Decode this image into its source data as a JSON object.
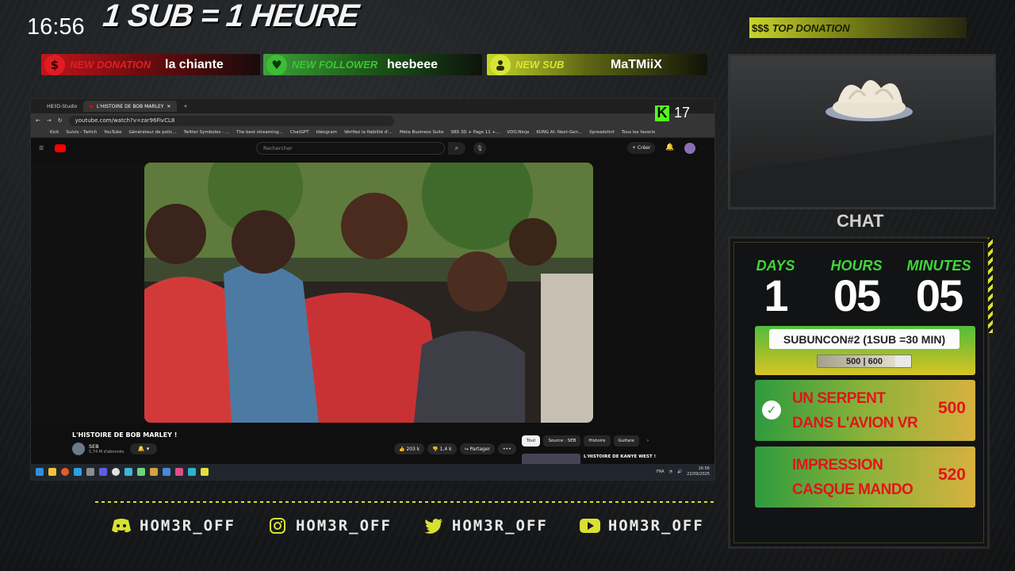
{
  "clock": "16:56",
  "headline": "1 SUB = 1 HEURE",
  "alerts": {
    "donation": {
      "label": "NEW DONATION",
      "value": "la chiante",
      "icon": "dollar-icon"
    },
    "follower": {
      "label": "NEW FOLLOWER",
      "value": "heebeee",
      "icon": "heart-icon"
    },
    "sub": {
      "label": "NEW SUB",
      "value": "MaTMiiX",
      "icon": "user-group-icon"
    }
  },
  "top_donation": {
    "icon_text": "$$$",
    "label": "TOP DONATION"
  },
  "chat_title": "CHAT",
  "timer": {
    "days_label": "DAYS",
    "days": "1",
    "hours_label": "HOURS",
    "hours": "05",
    "minutes_label": "MINUTES",
    "minutes": "05"
  },
  "subathon": {
    "title": "SUBUNCON#2 (1SUB =30 MIN)",
    "progress_text": "500 | 600",
    "current": 500,
    "goal": 600
  },
  "goals": [
    {
      "text": "UN SERPENT DANS L'AVION VR",
      "value": "500",
      "done": true
    },
    {
      "text": "IMPRESSION CASQUE MANDO",
      "value": "520",
      "done": false
    }
  ],
  "kick": {
    "viewers": "17"
  },
  "browser": {
    "tabs": [
      "HB3D-Studio",
      "L'HISTOIRE DE BOB MARLEY"
    ],
    "url": "youtube.com/watch?v=zar96FivCL8",
    "bookmarks": [
      "Kick",
      "Suivis - Twitch",
      "YouTube",
      "Générateur de polic...",
      "Twitter Symboles - ...",
      "The best streaming...",
      "ChatGPT",
      "Idéogram",
      "Vérifiez la fiabilité d'...",
      "Meta Business Suite",
      "SBS 3D + Page 11 +...",
      "VDO.Ninja",
      "KUNG AI: Next-Gen...",
      "Spreadshirt",
      "Tous les favoris"
    ],
    "search_placeholder": "Rechercher",
    "create_label": "+ Créer",
    "video_title": "L'HISTOIRE DE BOB MARLEY !",
    "channel": "SEB",
    "subscribers": "5,74 M d'abonnés",
    "likes": "203 k",
    "dislikes": "1,4 k",
    "share": "Partager",
    "chips": [
      "Tout",
      "Source : SEB",
      "Histoire",
      "Guitare"
    ],
    "rec_title": "L'HISTOIRE DE KANYE WEST !",
    "taskbar_lang": "FRA",
    "taskbar_time": "16:56",
    "taskbar_date": "22/09/2025"
  },
  "socials": [
    {
      "icon": "discord-icon",
      "handle": "HOM3R_OFF"
    },
    {
      "icon": "instagram-icon",
      "handle": "HOM3R_OFF"
    },
    {
      "icon": "twitter-icon",
      "handle": "HOM3R_OFF"
    },
    {
      "icon": "youtube-icon",
      "handle": "HOM3R_OFF"
    }
  ],
  "colors": {
    "accent_yellow": "#d9e033",
    "accent_green": "#3fd63a",
    "donation_red": "#e11d24",
    "follower_green": "#3cbd35"
  }
}
